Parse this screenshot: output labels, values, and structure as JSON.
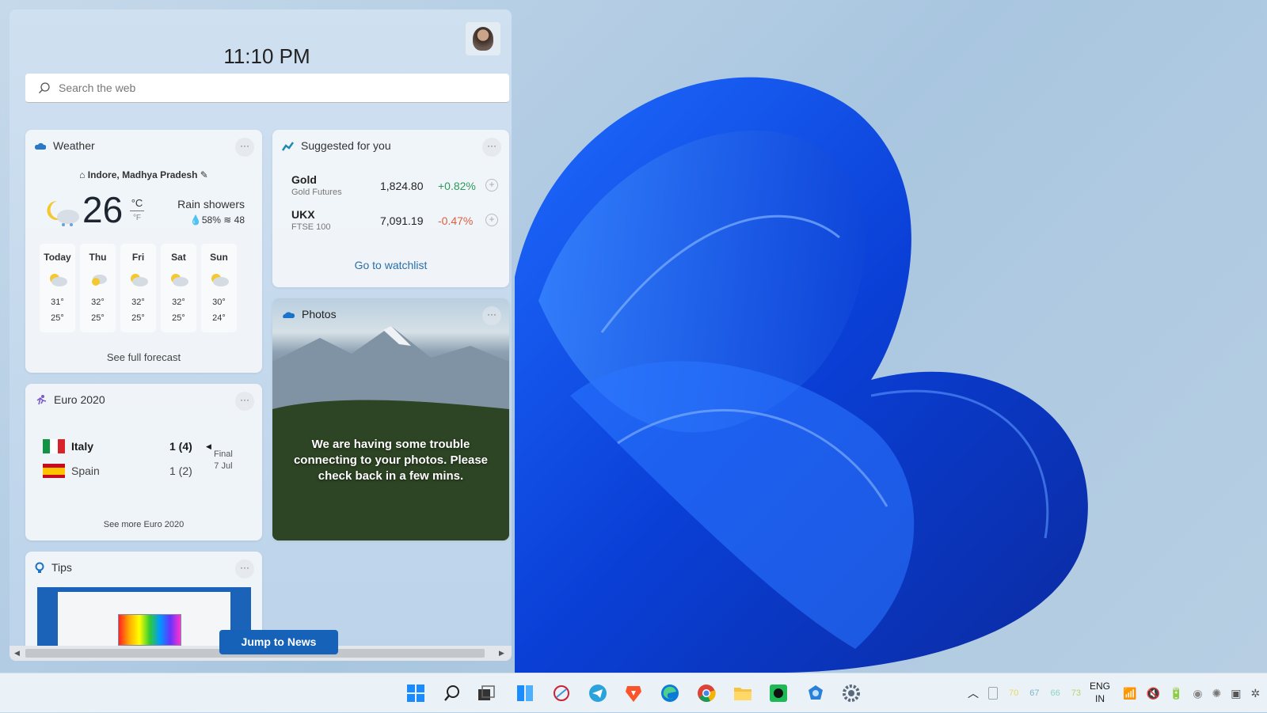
{
  "header": {
    "time": "11:10 PM",
    "search_placeholder": "Search the web"
  },
  "weather": {
    "title": "Weather",
    "location": "Indore, Madhya Pradesh",
    "temp": "26",
    "unit_c": "°C",
    "unit_f": "°F",
    "condition": "Rain showers",
    "precip": "58%",
    "aqi": "48",
    "forecast": [
      {
        "day": "Today",
        "hi": "31°",
        "lo": "25°"
      },
      {
        "day": "Thu",
        "hi": "32°",
        "lo": "25°"
      },
      {
        "day": "Fri",
        "hi": "32°",
        "lo": "25°"
      },
      {
        "day": "Sat",
        "hi": "32°",
        "lo": "25°"
      },
      {
        "day": "Sun",
        "hi": "30°",
        "lo": "24°"
      }
    ],
    "link": "See full forecast"
  },
  "stocks": {
    "title": "Suggested for you",
    "items": [
      {
        "symbol": "Gold",
        "name": "Gold Futures",
        "price": "1,824.80",
        "change": "+0.82%",
        "color": "#2e9a5a"
      },
      {
        "symbol": "UKX",
        "name": "FTSE 100",
        "price": "7,091.19",
        "change": "-0.47%",
        "color": "#d9603f"
      }
    ],
    "link": "Go to watchlist"
  },
  "photos": {
    "title": "Photos",
    "message": "We are having some trouble connecting to your photos. Please check back in a few mins."
  },
  "euro": {
    "title": "Euro 2020",
    "teams": [
      {
        "name": "Italy",
        "score": "1 (4)"
      },
      {
        "name": "Spain",
        "score": "1 (2)"
      }
    ],
    "status": "Final",
    "date": "7 Jul",
    "link": "See more Euro 2020"
  },
  "tips": {
    "title": "Tips"
  },
  "jump_label": "Jump to News",
  "more_label": "···",
  "taskbar": {
    "icons": [
      "start-icon",
      "search-icon",
      "task-view-icon",
      "widgets-icon",
      "app-icon",
      "telegram-icon",
      "brave-icon",
      "edge-icon",
      "chrome-icon",
      "file-explorer-icon",
      "spotify-icon",
      "app-icon",
      "settings-icon"
    ],
    "tray_values": [
      "70",
      "67",
      "66",
      "73"
    ],
    "tray_colors": [
      "#e8d86a",
      "#7fb6c8",
      "#8fd6c0",
      "#b6d66a"
    ],
    "lang": "ENG",
    "region": "IN"
  },
  "accent": "#1662b8"
}
